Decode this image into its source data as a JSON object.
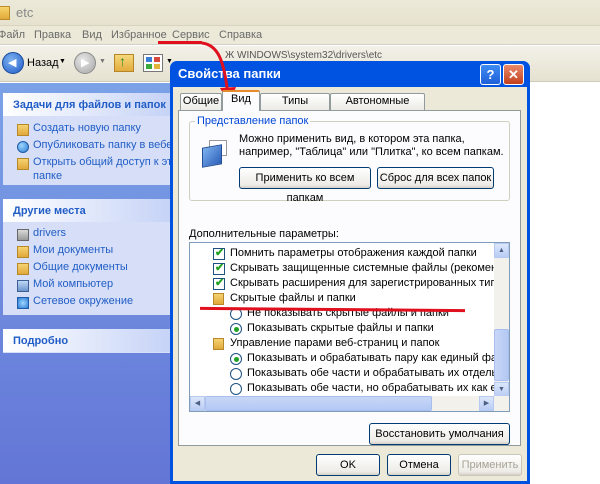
{
  "explorer": {
    "title": "etc",
    "menu": [
      "Файл",
      "Правка",
      "Вид",
      "Избранное",
      "Сервис",
      "Справка"
    ],
    "toolbar": {
      "back_label": "Назад"
    },
    "address_fragment": "Ж WINDOWS\\system32\\drivers\\etc"
  },
  "taskpane": {
    "tasks_title": "Задачи для файлов и папок",
    "tasks": [
      {
        "label": "Создать новую папку",
        "icon": "new-folder-icon"
      },
      {
        "label": "Опубликовать папку в вебе",
        "icon": "globe-icon"
      },
      {
        "label": "Открыть общий доступ к этой",
        "icon": "share-icon"
      },
      {
        "label": "папке",
        "icon": ""
      }
    ],
    "places_title": "Другие места",
    "places": [
      {
        "label": "drivers",
        "icon": "folder-icon"
      },
      {
        "label": "Мои документы",
        "icon": "documents-icon"
      },
      {
        "label": "Общие документы",
        "icon": "folder-icon"
      },
      {
        "label": "Мой компьютер",
        "icon": "computer-icon"
      },
      {
        "label": "Сетевое окружение",
        "icon": "network-icon"
      }
    ],
    "details_title": "Подробно"
  },
  "dialog": {
    "title": "Свойства папки",
    "help": "?",
    "close": "✕",
    "tabs": [
      "Общие",
      "Вид",
      "Типы файлов",
      "Автономные файлы"
    ],
    "active_tab": "Вид",
    "group_title": "Представление папок",
    "group_desc": "Можно применить вид, в котором эта папка, например, \"Таблица\" или \"Плитка\", ко всем папкам.",
    "apply_all": "Применить ко всем папкам",
    "reset_all": "Сброс для всех папок",
    "advanced_label": "Дополнительные параметры:",
    "advanced": [
      {
        "kind": "check",
        "checked": true,
        "label": "Помнить параметры отображения каждой папки"
      },
      {
        "kind": "check",
        "checked": true,
        "label": "Скрывать защищенные системные файлы (рекомендуется)"
      },
      {
        "kind": "check",
        "checked": true,
        "label": "Скрывать расширения для зарегистрированных типов файлов"
      },
      {
        "kind": "folder",
        "label": "Скрытые файлы и папки"
      },
      {
        "kind": "radio",
        "checked": false,
        "label": "Не показывать скрытые файлы и папки"
      },
      {
        "kind": "radio",
        "checked": true,
        "label": "Показывать скрытые файлы и папки"
      },
      {
        "kind": "folder",
        "label": "Управление парами веб-страниц и папок"
      },
      {
        "kind": "radio",
        "checked": true,
        "label": "Показывать и обрабатывать пару как единый файл"
      },
      {
        "kind": "radio",
        "checked": false,
        "label": "Показывать обе части и обрабатывать их отдельно"
      },
      {
        "kind": "radio",
        "checked": false,
        "label": "Показывать обе части, но обрабатывать их как единый файл"
      }
    ],
    "restore_defaults": "Восстановить умолчания",
    "ok": "OK",
    "cancel": "Отмена",
    "apply": "Применить"
  },
  "colors": {
    "xp_blue": "#0053E1",
    "annotation_red": "#E0101F",
    "link_blue": "#215DC6"
  }
}
